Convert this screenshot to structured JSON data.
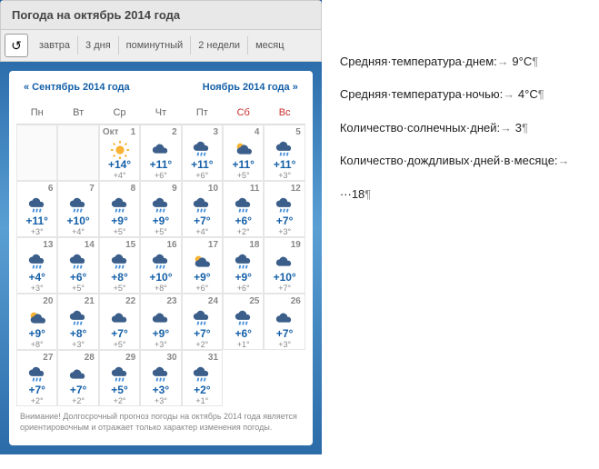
{
  "header": {
    "title": "Погода на октябрь 2014 года"
  },
  "tabs": [
    "завтра",
    "3 дня",
    "поминутный",
    "2 недели",
    "месяц"
  ],
  "nav": {
    "prev": "« Сентябрь 2014 года",
    "next": "Ноябрь 2014 года »"
  },
  "dayHeaders": [
    "Пн",
    "Вт",
    "Ср",
    "Чт",
    "Пт",
    "Сб",
    "Вс"
  ],
  "monthLabel": "Окт",
  "days": [
    {
      "d": 1,
      "hi": "+14°",
      "lo": "+4°",
      "ic": "sun",
      "first": true
    },
    {
      "d": 2,
      "hi": "+11°",
      "lo": "+6°",
      "ic": "cloud"
    },
    {
      "d": 3,
      "hi": "+11°",
      "lo": "+6°",
      "ic": "rain"
    },
    {
      "d": 4,
      "hi": "+11°",
      "lo": "+5°",
      "ic": "partly"
    },
    {
      "d": 5,
      "hi": "+11°",
      "lo": "+3°",
      "ic": "rain"
    },
    {
      "d": 6,
      "hi": "+11°",
      "lo": "+3°",
      "ic": "rain"
    },
    {
      "d": 7,
      "hi": "+10°",
      "lo": "+4°",
      "ic": "rain"
    },
    {
      "d": 8,
      "hi": "+9°",
      "lo": "+5°",
      "ic": "rain"
    },
    {
      "d": 9,
      "hi": "+9°",
      "lo": "+5°",
      "ic": "rain"
    },
    {
      "d": 10,
      "hi": "+7°",
      "lo": "+4°",
      "ic": "rain"
    },
    {
      "d": 11,
      "hi": "+6°",
      "lo": "+2°",
      "ic": "rain"
    },
    {
      "d": 12,
      "hi": "+7°",
      "lo": "+3°",
      "ic": "rain"
    },
    {
      "d": 13,
      "hi": "+4°",
      "lo": "+3°",
      "ic": "rain"
    },
    {
      "d": 14,
      "hi": "+6°",
      "lo": "+5°",
      "ic": "rain"
    },
    {
      "d": 15,
      "hi": "+8°",
      "lo": "+5°",
      "ic": "rain"
    },
    {
      "d": 16,
      "hi": "+10°",
      "lo": "+8°",
      "ic": "rain"
    },
    {
      "d": 17,
      "hi": "+9°",
      "lo": "+6°",
      "ic": "partly"
    },
    {
      "d": 18,
      "hi": "+9°",
      "lo": "+6°",
      "ic": "rain"
    },
    {
      "d": 19,
      "hi": "+10°",
      "lo": "+7°",
      "ic": "cloud"
    },
    {
      "d": 20,
      "hi": "+9°",
      "lo": "+8°",
      "ic": "partly"
    },
    {
      "d": 21,
      "hi": "+8°",
      "lo": "+3°",
      "ic": "rain"
    },
    {
      "d": 22,
      "hi": "+7°",
      "lo": "+5°",
      "ic": "cloud"
    },
    {
      "d": 23,
      "hi": "+9°",
      "lo": "+3°",
      "ic": "cloud"
    },
    {
      "d": 24,
      "hi": "+7°",
      "lo": "+2°",
      "ic": "rain"
    },
    {
      "d": 25,
      "hi": "+6°",
      "lo": "+1°",
      "ic": "rain"
    },
    {
      "d": 26,
      "hi": "+7°",
      "lo": "+3°",
      "ic": "cloud"
    },
    {
      "d": 27,
      "hi": "+7°",
      "lo": "+2°",
      "ic": "rain"
    },
    {
      "d": 28,
      "hi": "+7°",
      "lo": "+2°",
      "ic": "cloud"
    },
    {
      "d": 29,
      "hi": "+5°",
      "lo": "+2°",
      "ic": "rain"
    },
    {
      "d": 30,
      "hi": "+3°",
      "lo": "+3°",
      "ic": "rain"
    },
    {
      "d": 31,
      "hi": "+2°",
      "lo": "+1°",
      "ic": "rain"
    }
  ],
  "note": "Внимание! Долгосрочный прогноз погоды на октябрь 2014 года является ориентировочным и отражает только характер изменения погоды.",
  "stats": [
    {
      "label": "Средняя·температура·днем:",
      "val": "9°C"
    },
    {
      "label": "Средняя·температура·ночью:",
      "val": "4°C"
    },
    {
      "label": "Количество·солнечных·дней:",
      "val": "3"
    },
    {
      "label": "Количество·дождливых·дней·в·месяце:",
      "val": "···18"
    }
  ]
}
